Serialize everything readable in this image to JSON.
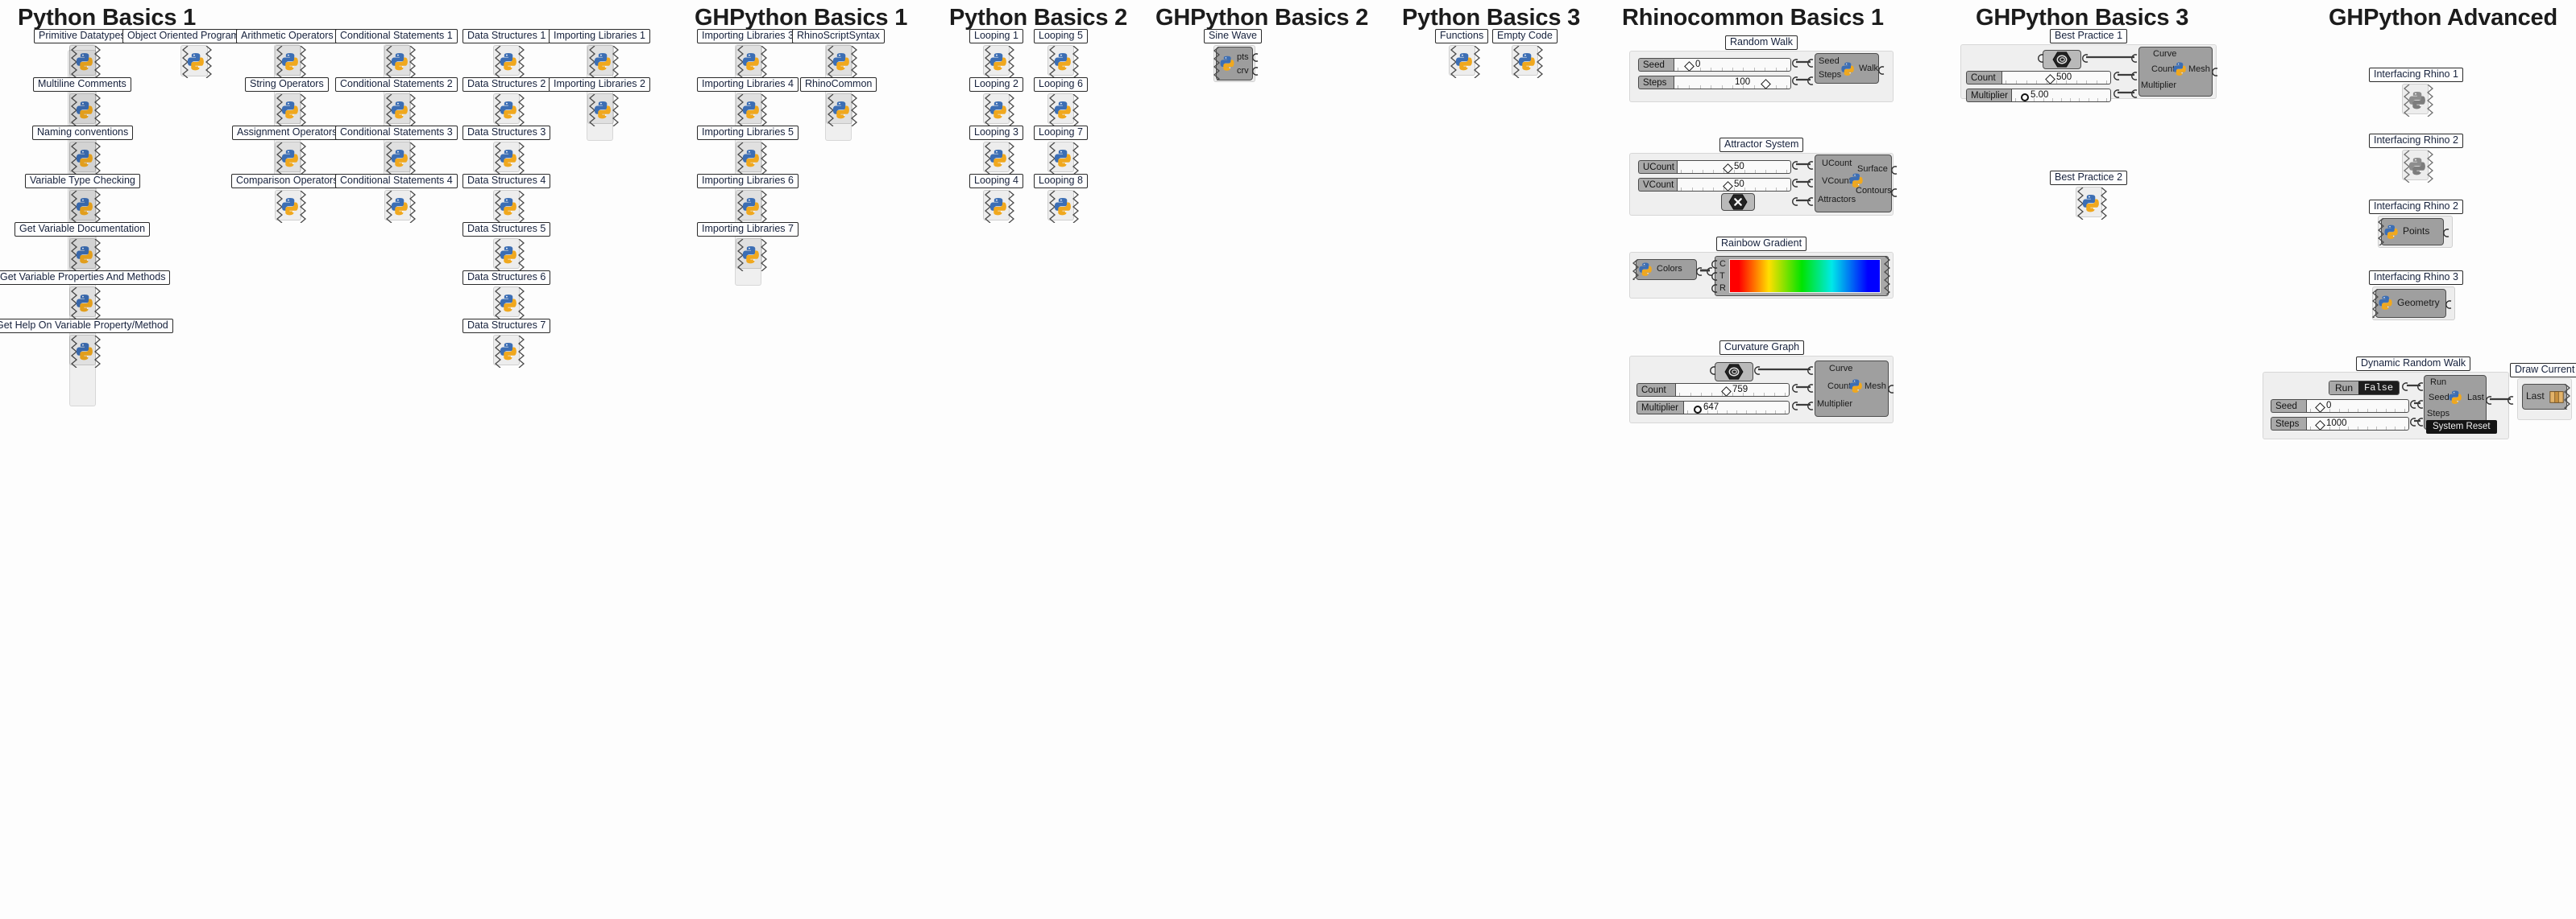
{
  "app": {
    "kind": "grasshopper-canvas",
    "background": "#fdfdfd",
    "accent": "#16213c"
  },
  "sections": [
    {
      "id": "python-basics-1",
      "title": "Python Basics 1"
    },
    {
      "id": "ghpython-basics-1",
      "title": "GHPython Basics 1"
    },
    {
      "id": "python-basics-2",
      "title": "Python Basics 2"
    },
    {
      "id": "ghpython-basics-2",
      "title": "GHPython Basics 2"
    },
    {
      "id": "python-basics-3",
      "title": "Python Basics 3"
    },
    {
      "id": "rhinocommon-basics-1",
      "title": "Rhinocommon Basics 1"
    },
    {
      "id": "ghpython-basics-3",
      "title": "GHPython Basics 3"
    },
    {
      "id": "ghpython-advanced",
      "title": "GHPython Advanced"
    }
  ],
  "plates": [
    {
      "id": "p01",
      "label": "Primitive Datatypes"
    },
    {
      "id": "p02",
      "label": "Multiline Comments"
    },
    {
      "id": "p03",
      "label": "Naming conventions"
    },
    {
      "id": "p04",
      "label": "Variable Type Checking"
    },
    {
      "id": "p05",
      "label": "Get Variable Documentation"
    },
    {
      "id": "p06",
      "label": "Get Variable Properties And Methods"
    },
    {
      "id": "p07",
      "label": "Get Help On Variable Property/Method"
    },
    {
      "id": "p08",
      "label": "Object Oriented Programming"
    },
    {
      "id": "p09",
      "label": "Arithmetic Operators"
    },
    {
      "id": "p10",
      "label": "String Operators"
    },
    {
      "id": "p11",
      "label": "Assignment Operators"
    },
    {
      "id": "p12",
      "label": "Comparison Operators"
    },
    {
      "id": "p13",
      "label": "Conditional Statements 1"
    },
    {
      "id": "p14",
      "label": "Conditional Statements 2"
    },
    {
      "id": "p15",
      "label": "Conditional Statements 3"
    },
    {
      "id": "p16",
      "label": "Conditional Statements 4"
    },
    {
      "id": "p17",
      "label": "Data Structures 1"
    },
    {
      "id": "p18",
      "label": "Data Structures 2"
    },
    {
      "id": "p19",
      "label": "Data Structures 3"
    },
    {
      "id": "p20",
      "label": "Data Structures 4"
    },
    {
      "id": "p21",
      "label": "Data Structures 5"
    },
    {
      "id": "p22",
      "label": "Data Structures 6"
    },
    {
      "id": "p23",
      "label": "Data Structures 7"
    },
    {
      "id": "p24",
      "label": "Importing Libraries 1"
    },
    {
      "id": "p25",
      "label": "Importing Libraries 2"
    },
    {
      "id": "p26",
      "label": "Importing Libraries 3"
    },
    {
      "id": "p27",
      "label": "Importing Libraries 4"
    },
    {
      "id": "p28",
      "label": "Importing Libraries 5"
    },
    {
      "id": "p29",
      "label": "Importing Libraries 6"
    },
    {
      "id": "p30",
      "label": "Importing Libraries 7"
    },
    {
      "id": "p31",
      "label": "RhinoScriptSyntax"
    },
    {
      "id": "p32",
      "label": "RhinoCommon"
    },
    {
      "id": "p33",
      "label": "Looping 1"
    },
    {
      "id": "p34",
      "label": "Looping 2"
    },
    {
      "id": "p35",
      "label": "Looping 3"
    },
    {
      "id": "p36",
      "label": "Looping 4"
    },
    {
      "id": "p37",
      "label": "Looping 5"
    },
    {
      "id": "p38",
      "label": "Looping 6"
    },
    {
      "id": "p39",
      "label": "Looping 7"
    },
    {
      "id": "p40",
      "label": "Looping 8"
    },
    {
      "id": "p41",
      "label": "Sine Wave"
    },
    {
      "id": "p42",
      "label": "Functions"
    },
    {
      "id": "p43",
      "label": "Empty Code"
    },
    {
      "id": "p44",
      "label": "Random Walk"
    },
    {
      "id": "p45",
      "label": "Attractor System"
    },
    {
      "id": "p46",
      "label": "Rainbow Gradient"
    },
    {
      "id": "p47",
      "label": "Curvature Graph"
    },
    {
      "id": "p48",
      "label": "Best Practice 1"
    },
    {
      "id": "p49",
      "label": "Best Practice 2"
    },
    {
      "id": "p50",
      "label": "Interfacing Rhino 1"
    },
    {
      "id": "p51",
      "label": "Interfacing Rhino 2"
    },
    {
      "id": "p52",
      "label": "Interfacing Rhino 2"
    },
    {
      "id": "p53",
      "label": "Interfacing Rhino 3"
    },
    {
      "id": "p54",
      "label": "Dynamic Random Walk"
    },
    {
      "id": "p55",
      "label": "Draw Current"
    }
  ],
  "components": {
    "sine_wave": {
      "outputs": [
        "pts",
        "crv"
      ]
    },
    "random_walk": {
      "inputs": [
        "Seed",
        "Steps"
      ],
      "outputs": [
        "Walk"
      ]
    },
    "attractor": {
      "inputs": [
        "UCount",
        "VCount",
        "Attractors"
      ],
      "outputs": [
        "Surface",
        "Contours"
      ]
    },
    "rainbow": {
      "input_label": "Colors",
      "gradient_inputs": [
        "C",
        "T",
        "R"
      ]
    },
    "curvature": {
      "inputs": [
        "Curve",
        "Count",
        "Multiplier"
      ],
      "outputs": [
        "Mesh"
      ]
    },
    "best_practice_1": {
      "inputs": [
        "Curve",
        "Count",
        "Multiplier"
      ],
      "outputs": [
        "Mesh"
      ]
    },
    "interfacing_rhino_2": {
      "outputs": [
        "Points"
      ]
    },
    "interfacing_rhino_3": {
      "outputs": [
        "Geometry"
      ]
    },
    "dynamic_random_walk": {
      "inputs": [
        "Run",
        "Seed",
        "Steps"
      ],
      "outputs": [
        "Last"
      ],
      "status": "System Reset"
    },
    "draw_current": {
      "label": "Last"
    }
  },
  "sliders": {
    "rw_seed": {
      "label": "Seed",
      "value": "0",
      "grip": "left",
      "shape": "diamond"
    },
    "rw_steps": {
      "label": "Steps",
      "value": "100",
      "grip": "right",
      "shape": "diamond"
    },
    "at_ucount": {
      "label": "UCount",
      "value": "50",
      "grip": "mid",
      "shape": "diamond"
    },
    "at_vcount": {
      "label": "VCount",
      "value": "50",
      "grip": "mid",
      "shape": "diamond"
    },
    "cg_count": {
      "label": "Count",
      "value": "759",
      "grip": "mid",
      "shape": "diamond"
    },
    "cg_mult": {
      "label": "Multiplier",
      "value": "647",
      "grip": "left",
      "shape": "round"
    },
    "bp_count": {
      "label": "Count",
      "value": "500",
      "grip": "mid",
      "shape": "diamond"
    },
    "bp_mult": {
      "label": "Multiplier",
      "value": "5.00",
      "grip": "left",
      "shape": "round"
    },
    "dw_seed": {
      "label": "Seed",
      "value": "0",
      "grip": "left",
      "shape": "diamond"
    },
    "dw_steps": {
      "label": "Steps",
      "value": "1000",
      "grip": "left",
      "shape": "diamond"
    }
  },
  "toggles": {
    "dw_run": {
      "label": "Run",
      "state": "False"
    }
  }
}
